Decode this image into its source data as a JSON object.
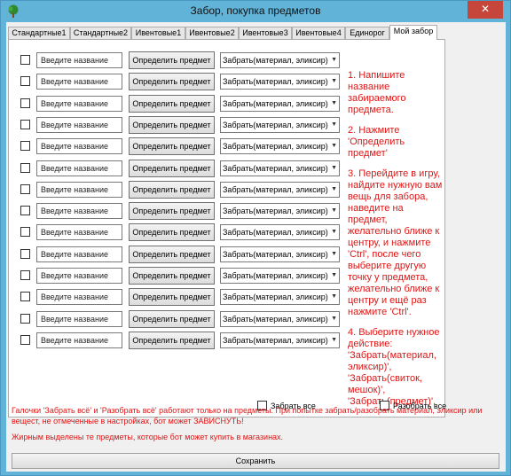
{
  "window": {
    "title": "Забор, покупка предметов",
    "close_symbol": "✕",
    "accent_color": "#62b3d8",
    "close_color": "#c7463b"
  },
  "tabs": [
    {
      "label": "Стандартные1"
    },
    {
      "label": "Стандартные2"
    },
    {
      "label": "Ивентовые1"
    },
    {
      "label": "Ивентовые2"
    },
    {
      "label": "Ивентовые3"
    },
    {
      "label": "Ивентовые4"
    },
    {
      "label": "Единорог"
    },
    {
      "label": "Мой забор",
      "active": true
    }
  ],
  "rows": {
    "name_placeholder": "Введите название",
    "detect_label": "Определить предмет",
    "action_value": "Забрать(материал, эликсир)",
    "count": 14
  },
  "instructions": [
    "1. Напишите название забираемого предмета.",
    "2. Нажмите 'Определить предмет'",
    "3. Перейдите в игру, найдите нужную вам вещь для забора, наведите на предмет, желательно ближе к центру, и нажмите 'Ctrl', после чего выберите другую точку у предмета, желательно ближе к центру и ещё раз нажмите 'Ctrl'.",
    "4. Выберите нужное действие: 'Забрать(материал, эликсир)', 'Забрать(свиток, мешок)', 'Забрать(предмет)'."
  ],
  "take_all_label": "Забрать все",
  "disassemble_all_label": "Разобрать все",
  "notes": [
    "Галочки 'Забрать всё' и 'Разобрать всё' работают только на предметы. При попытке забрать/разобрать материал, эликсир или вещест, не отмеченные в настройках, бот может ЗАВИСНУТЬ!",
    "Жирным выделены те предметы, которые бот может купить в магазинах."
  ],
  "save_label": "Сохранить",
  "instruction_color": "#e01414"
}
